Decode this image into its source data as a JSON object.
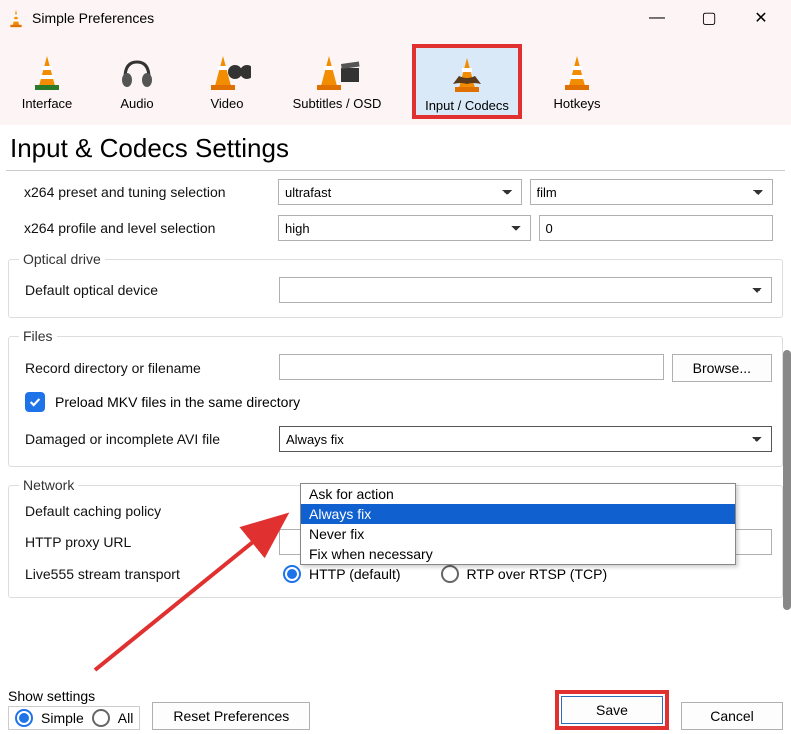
{
  "window": {
    "title": "Simple Preferences",
    "min": "—",
    "max": "▢",
    "close": "✕"
  },
  "tabs": {
    "interface": "Interface",
    "audio": "Audio",
    "video": "Video",
    "subtitles": "Subtitles / OSD",
    "input_codecs": "Input / Codecs",
    "hotkeys": "Hotkeys"
  },
  "heading": "Input & Codecs Settings",
  "x264": {
    "preset_label": "x264 preset and tuning selection",
    "preset_value": "ultrafast",
    "tune_value": "film",
    "profile_label": "x264 profile and level selection",
    "profile_value": "high",
    "level_value": "0"
  },
  "optical": {
    "legend": "Optical drive",
    "default_label": "Default optical device",
    "default_value": ""
  },
  "files": {
    "legend": "Files",
    "record_label": "Record directory or filename",
    "record_value": "",
    "browse": "Browse...",
    "preload_label": "Preload MKV files in the same directory",
    "avi_label": "Damaged or incomplete AVI file",
    "avi_value": "Always fix",
    "avi_options": [
      "Ask for action",
      "Always fix",
      "Never fix",
      "Fix when necessary"
    ]
  },
  "network": {
    "legend": "Network",
    "caching_label": "Default caching policy",
    "proxy_label": "HTTP proxy URL",
    "proxy_value": "",
    "live555_label": "Live555 stream transport",
    "http_label": "HTTP (default)",
    "rtp_label": "RTP over RTSP (TCP)"
  },
  "bottom": {
    "show_settings": "Show settings",
    "simple": "Simple",
    "all": "All",
    "reset": "Reset Preferences",
    "save": "Save",
    "cancel": "Cancel"
  }
}
